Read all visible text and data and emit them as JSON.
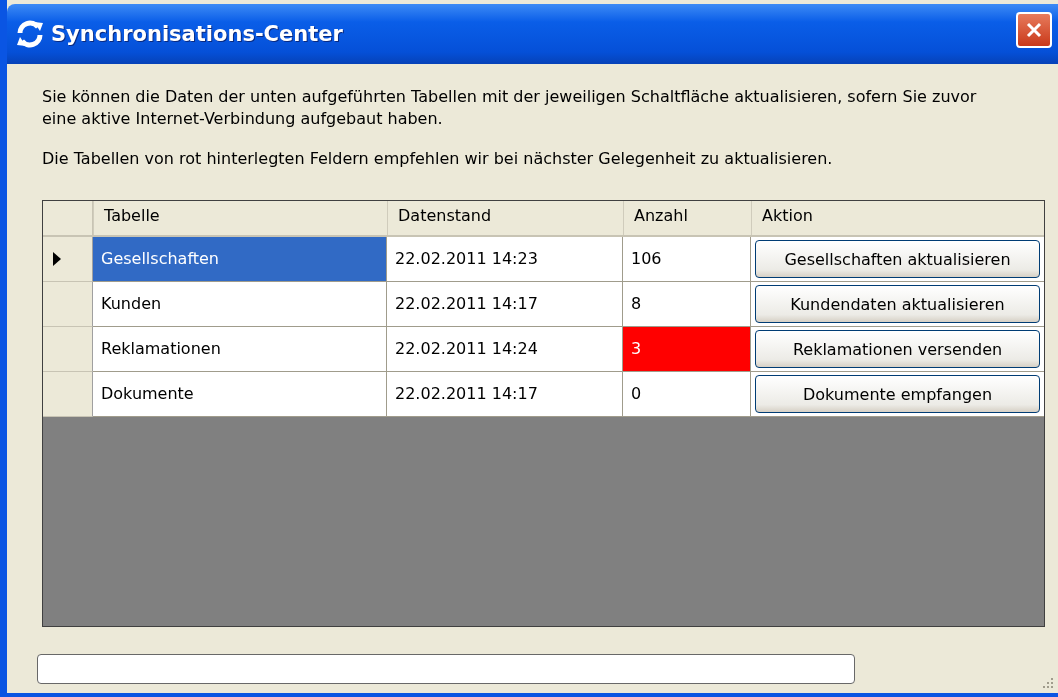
{
  "window": {
    "title": "Synchronisations-Center"
  },
  "intro": "Sie können die Daten der unten aufgeführten Tabellen mit der jeweiligen Schaltfläche aktualisieren, sofern Sie zuvor eine aktive Internet-Verbindung aufgebaut haben.",
  "hint": "Die Tabellen von rot hinterlegten Feldern empfehlen wir bei nächster Gelegenheit zu aktualisieren.",
  "table": {
    "columns": [
      "Tabelle",
      "Datenstand",
      "Anzahl",
      "Aktion"
    ],
    "rows": [
      {
        "table": "Gesellschaften",
        "date": "22.02.2011 14:23",
        "count": "106",
        "count_alert": false,
        "action": "Gesellschaften aktualisieren",
        "selected": true
      },
      {
        "table": "Kunden",
        "date": "22.02.2011 14:17",
        "count": "8",
        "count_alert": false,
        "action": "Kundendaten aktualisieren",
        "selected": false
      },
      {
        "table": "Reklamationen",
        "date": "22.02.2011 14:24",
        "count": "3",
        "count_alert": true,
        "action": "Reklamationen versenden",
        "selected": false
      },
      {
        "table": "Dokumente",
        "date": "22.02.2011 14:17",
        "count": "0",
        "count_alert": false,
        "action": "Dokumente empfangen",
        "selected": false
      }
    ]
  },
  "status_bar": {
    "progress": {
      "level": 0
    }
  }
}
